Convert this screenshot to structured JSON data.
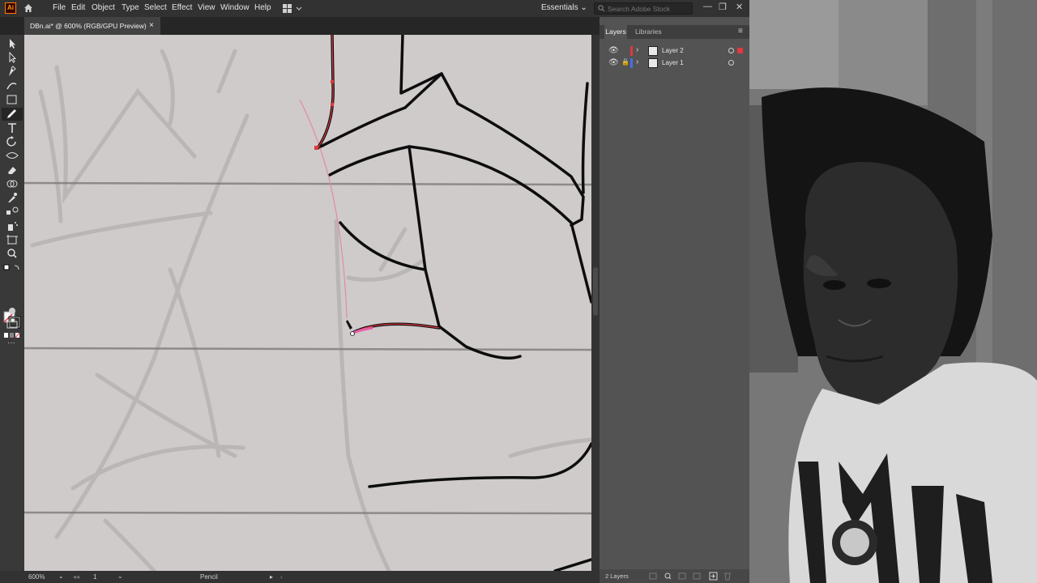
{
  "menubar": {
    "app_icon_label": "Ai",
    "items": [
      "File",
      "Edit",
      "Object",
      "Type",
      "Select",
      "Effect",
      "View",
      "Window",
      "Help"
    ],
    "workspace": "Essentials",
    "workspace_chevron": "⌄",
    "stock_search_placeholder": "Search Adobe Stock",
    "window_controls": [
      "—",
      "❐",
      "✕"
    ]
  },
  "document_tab": {
    "title": "DBn.ai* @ 600% (RGB/GPU Preview)",
    "close": "×"
  },
  "toolbar": {
    "tools": [
      "selection-tool",
      "direct-selection-tool",
      "pen-tool",
      "curvature-tool",
      "rectangle-tool",
      "pencil-tool",
      "type-tool",
      "rotate-tool",
      "width-tool",
      "eraser-tool",
      "shape-builder-tool",
      "eyedropper-tool",
      "blend-tool",
      "symbol-sprayer-tool",
      "artboard-tool",
      "zoom-tool"
    ],
    "more": "···"
  },
  "status": {
    "zoom": "600%",
    "artboard": "1",
    "current_tool": "Pencil"
  },
  "panel": {
    "tabs": [
      "Layers",
      "Libraries"
    ],
    "menu_icon": "≡",
    "layers": [
      {
        "name": "Layer 2",
        "color": "#e0393e",
        "locked": false
      },
      {
        "name": "Layer 1",
        "color": "#4a6ee0",
        "locked": true
      }
    ],
    "footer_count": "2 Layers"
  },
  "colors": {
    "accent": "#ff7c00",
    "selection_path": "#e0393e",
    "canvas_paper": "#cfcbcb"
  }
}
